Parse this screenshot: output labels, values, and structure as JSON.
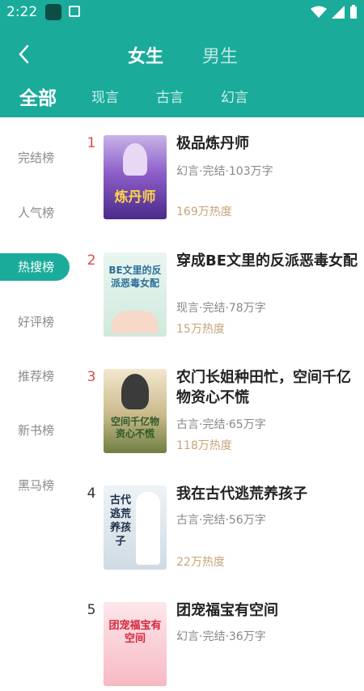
{
  "status": {
    "time": "2:22"
  },
  "nav": {
    "genders": [
      "女生",
      "男生"
    ],
    "active_gender": "女生"
  },
  "categories": [
    "全部",
    "现言",
    "古言",
    "幻言"
  ],
  "sidebar": [
    "完结榜",
    "人气榜",
    "热搜榜",
    "好评榜",
    "推荐榜",
    "新书榜",
    "黑马榜"
  ],
  "active_sidebar": "热搜榜",
  "books": [
    {
      "rank": "1",
      "title": "极品炼丹师",
      "meta": "幻言·完结·103万字",
      "heat": "169万热度",
      "cover_text": "炼丹师"
    },
    {
      "rank": "2",
      "title": "穿成BE文里的反派恶毒女配",
      "meta": "现言·完结·78万字",
      "heat": "15万热度",
      "cover_text": "BE文里的反派恶毒女配"
    },
    {
      "rank": "3",
      "title": "农门长姐种田忙，空间千亿物资心不慌",
      "meta": "古言·完结·65万字",
      "heat": "118万热度",
      "cover_text": "空间千亿物资心不慌"
    },
    {
      "rank": "4",
      "title": "我在古代逃荒养孩子",
      "meta": "古言·完结·56万字",
      "heat": "22万热度",
      "cover_text": "古代逃荒养孩子"
    },
    {
      "rank": "5",
      "title": "团宠福宝有空间",
      "meta": "幻言·完结·36万字",
      "heat": "",
      "cover_text": "团宠福宝有空间"
    }
  ],
  "colors": {
    "brand": "#1aab9b",
    "rank_hot": "#e04848",
    "heat": "#c8a47a"
  }
}
